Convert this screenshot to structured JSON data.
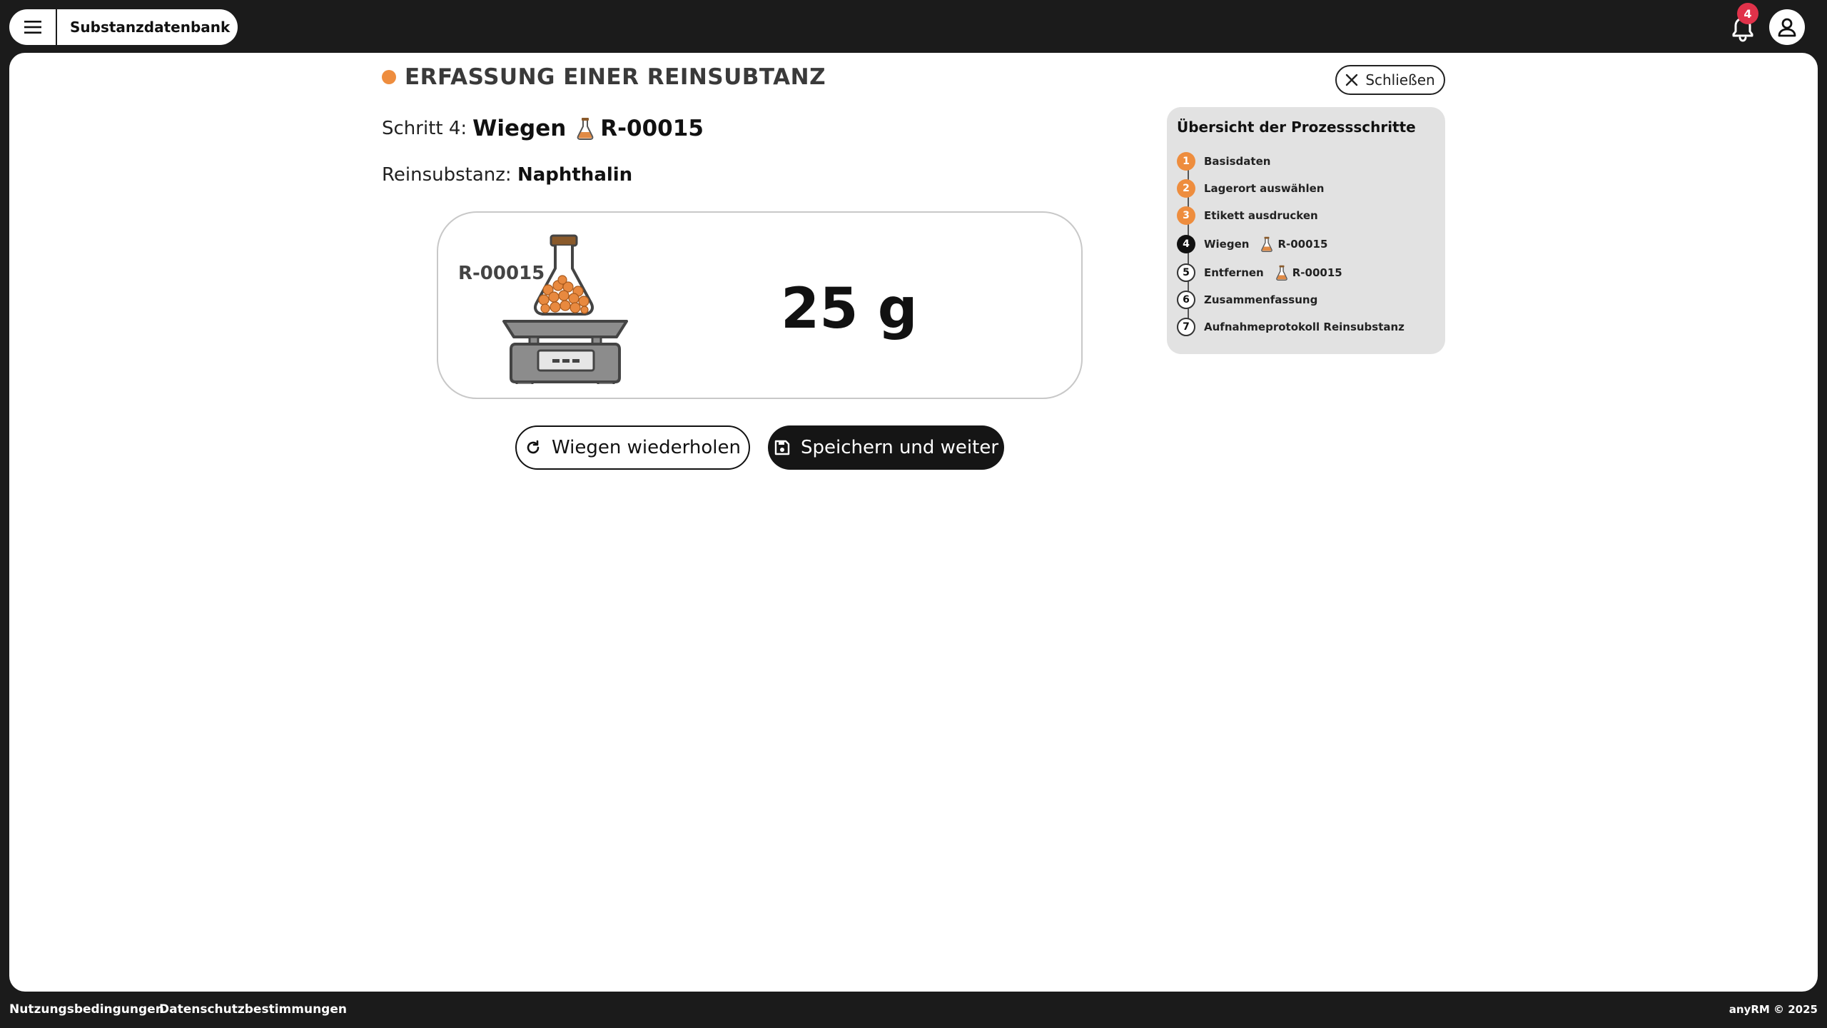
{
  "app": {
    "title": "Substanzdatenbank",
    "notification_count": "4"
  },
  "header": {
    "title": "ERFASSUNG EINER REINSUBTANZ",
    "close_label": "Schließen",
    "accent": "#ee8d3e"
  },
  "step": {
    "prefix": "Schritt 4:",
    "name": "Wiegen",
    "code": "R-00015"
  },
  "substance": {
    "label": "Reinsubstanz:",
    "name": "Naphthalin"
  },
  "weighing": {
    "code": "R-00015",
    "weight": "25 g"
  },
  "actions": {
    "repeat_label": "Wiegen wiederholen",
    "save_label": "Speichern und weiter"
  },
  "process": {
    "title": "Übersicht der Prozessschritte",
    "steps": [
      {
        "num": "1",
        "label": "Basisdaten",
        "state": "done"
      },
      {
        "num": "2",
        "label": "Lagerort auswählen",
        "state": "done"
      },
      {
        "num": "3",
        "label": "Etikett ausdrucken",
        "state": "done"
      },
      {
        "num": "4",
        "label": "Wiegen",
        "code": "R-00015",
        "state": "active"
      },
      {
        "num": "5",
        "label": "Entfernen",
        "code": "R-00015",
        "state": "todo"
      },
      {
        "num": "6",
        "label": "Zusammenfassung",
        "state": "todo"
      },
      {
        "num": "7",
        "label": "Aufnahmeprotokoll Reinsubstanz",
        "state": "todo"
      }
    ]
  },
  "footer": {
    "terms": "Nutzungsbedingungen",
    "privacy": "Datenschutzbestimmungen",
    "copyright": "anyRM © 2025"
  },
  "icons": {
    "menu": "hamburger-icon",
    "bell": "bell-icon",
    "user": "user-icon",
    "close": "x-icon",
    "flask": "flask-icon",
    "refresh": "refresh-icon",
    "save": "floppy-disk-icon"
  }
}
